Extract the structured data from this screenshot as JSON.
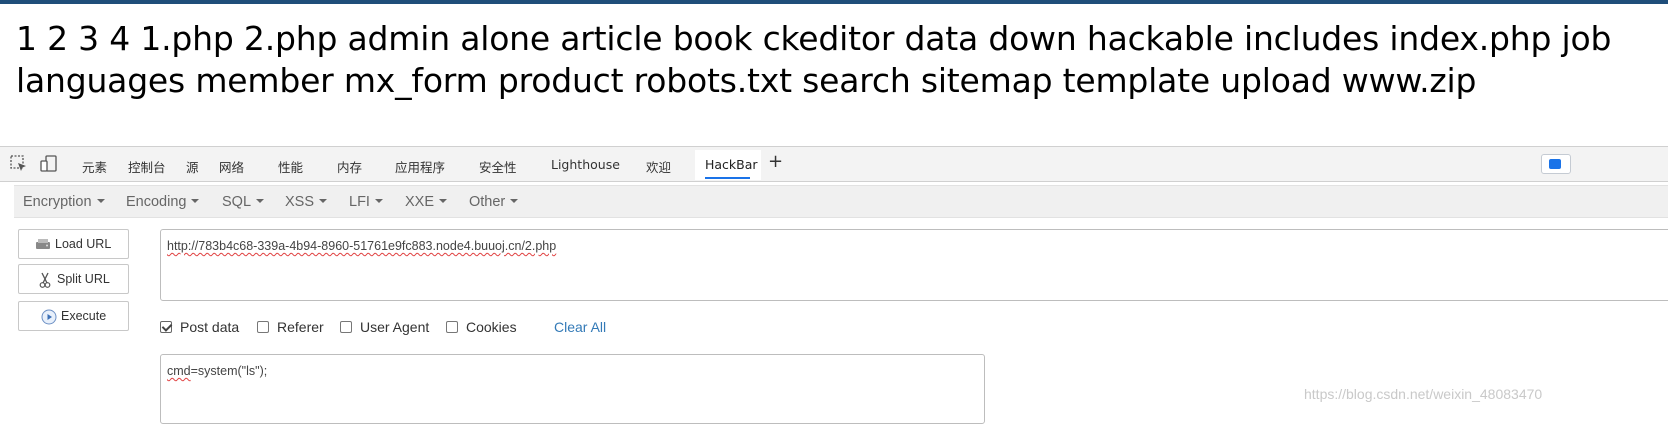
{
  "page": {
    "directory_listing": "1 2 3 4 1.php 2.php admin alone article book ckeditor data down hackable includes index.php job languages member mx_form product robots.txt search sitemap template upload www.zip"
  },
  "devtools": {
    "tabs": [
      "元素",
      "控制台",
      "源",
      "网络",
      "性能",
      "内存",
      "应用程序",
      "安全性",
      "Lighthouse",
      "欢迎"
    ],
    "active_tab": "HackBar",
    "add_tab_symbol": "+"
  },
  "hackbar": {
    "menu": [
      "Encryption",
      "Encoding",
      "SQL",
      "XSS",
      "LFI",
      "XXE",
      "Other"
    ],
    "buttons": {
      "load_url": "Load URL",
      "split_url": "Split URL",
      "execute": "Execute"
    },
    "url_value": "http://783b4c68-339a-4b94-8960-51761e9fc883.node4.buuoj.cn/2.php",
    "options": {
      "post_data": {
        "label": "Post data",
        "checked": true
      },
      "referer": {
        "label": "Referer",
        "checked": false
      },
      "user_agent": {
        "label": "User Agent",
        "checked": false
      },
      "cookies": {
        "label": "Cookies",
        "checked": false
      }
    },
    "clear_all": "Clear All",
    "post_value_prefix": "cmd",
    "post_value_rest": "=system(\"ls\");"
  },
  "watermark": "https://blog.csdn.net/weixin_48083470",
  "colors": {
    "top_strip": "#1f4e7a",
    "tab_underline": "#1a73e8",
    "link": "#337ab7"
  }
}
